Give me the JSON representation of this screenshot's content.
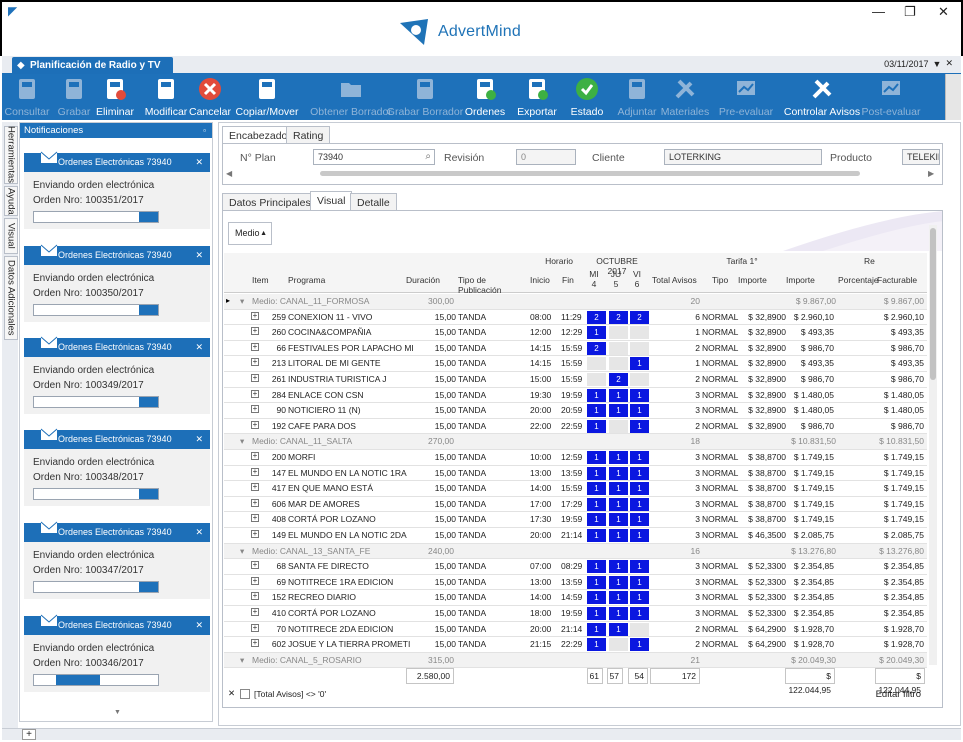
{
  "app": {
    "brand": "AdvertMind",
    "window_controls": [
      "—",
      "❐",
      "✕"
    ]
  },
  "doc_tab": {
    "title": "Planificación de Radio y TV",
    "date": "03/11/2017"
  },
  "toolbar": [
    {
      "label": "Consultar",
      "enabled": false,
      "icon": "magnifier-doc-icon"
    },
    {
      "label": "Grabar",
      "enabled": false,
      "icon": "floppy-icon"
    },
    {
      "label": "Eliminar",
      "enabled": true,
      "icon": "floppy-delete-icon"
    },
    {
      "label": "Modificar",
      "enabled": true,
      "icon": "edit-icon"
    },
    {
      "label": "Cancelar",
      "enabled": true,
      "icon": "cancel-icon"
    },
    {
      "label": "Copiar/Mover",
      "enabled": true,
      "icon": "copy-icon"
    },
    {
      "label": "Obtener Borrador",
      "enabled": false,
      "icon": "folder-icon"
    },
    {
      "label": "Grabar Borrador",
      "enabled": false,
      "icon": "floppy-icon"
    },
    {
      "label": "Ordenes",
      "enabled": true,
      "icon": "orders-icon"
    },
    {
      "label": "Exportar",
      "enabled": true,
      "icon": "export-icon"
    },
    {
      "label": "Estado",
      "enabled": true,
      "icon": "status-icon"
    },
    {
      "label": "Adjuntar",
      "enabled": false,
      "icon": "attach-icon"
    },
    {
      "label": "Materiales",
      "enabled": false,
      "icon": "tools-icon"
    },
    {
      "label": "Pre-evaluar",
      "enabled": false,
      "icon": "chart-icon"
    },
    {
      "label": "Controlar Avisos",
      "enabled": true,
      "icon": "tools-icon"
    },
    {
      "label": "Post-evaluar",
      "enabled": false,
      "icon": "chart-icon"
    }
  ],
  "side_tabs": [
    "Herramientas",
    "Ayuda",
    "Visual",
    "Datos Adicionales"
  ],
  "notifications": {
    "title": "Notificaciones",
    "items": [
      {
        "header": "Ordenes Electrónicas 73940",
        "line1": "Enviando orden electrónica",
        "line2": "Orden Nro: 100351/2017",
        "progress": 0.1
      },
      {
        "header": "Ordenes Electrónicas 73940",
        "line1": "Enviando orden electrónica",
        "line2": "Orden Nro: 100350/2017",
        "progress": 0.1
      },
      {
        "header": "Ordenes Electrónicas 73940",
        "line1": "Enviando orden electrónica",
        "line2": "Orden Nro: 100349/2017",
        "progress": 0.1
      },
      {
        "header": "Ordenes Electrónicas 73940",
        "line1": "Enviando orden electrónica",
        "line2": "Orden Nro: 100348/2017",
        "progress": 0.1
      },
      {
        "header": "Ordenes Electrónicas 73940",
        "line1": "Enviando orden electrónica",
        "line2": "Orden Nro: 100347/2017",
        "progress": 0.1
      },
      {
        "header": "Ordenes Electrónicas 73940",
        "line1": "Enviando orden electrónica",
        "line2": "Orden Nro: 100346/2017",
        "progress": 0.35
      }
    ]
  },
  "header_tabs": [
    "Encabezado",
    "Rating"
  ],
  "header_fields": {
    "plan_label": "N° Plan",
    "plan_value": "73940",
    "revision_label": "Revisión",
    "revision_value": "0",
    "client_label": "Cliente",
    "client_value": "LOTERKING",
    "product_label": "Producto",
    "product_value": "TELEKING"
  },
  "detail_tabs": [
    "Datos Principales",
    "Visual",
    "Detalle"
  ],
  "group_by": "Medio",
  "grid": {
    "band_headers": {
      "horario": "Horario",
      "month": "OCTUBRE 2017",
      "tarifa": "Tarifa 1°",
      "re": "Re"
    },
    "columns": [
      "Item",
      "Programa",
      "Duración",
      "Tipo de Publicación",
      "Inicio",
      "Fin",
      "MI 4",
      "JU 5",
      "VI 6",
      "Total Avisos",
      "Tipo",
      "Importe",
      "Importe",
      "Porcentaje",
      "Facturable"
    ],
    "groups": [
      {
        "label": "Medio: CANAL_11_FORMOSA",
        "duration": "300,00",
        "total": "20",
        "importe": "$ 9.867,00",
        "facturable": "$ 9.867,00",
        "rows": [
          {
            "item": "259",
            "program": "CONEXION 11 - VIVO",
            "dur": "15,00",
            "pub": "TANDA",
            "ini": "08:00",
            "fin": "11:29",
            "d": [
              "2",
              "2",
              "2"
            ],
            "total": "6",
            "tipo": "NORMAL",
            "imp1": "$ 32,8900",
            "imp2": "$ 2.960,10",
            "fact": "$ 2.960,10"
          },
          {
            "item": "260",
            "program": "COCINA&COMPAÑIA",
            "dur": "15,00",
            "pub": "TANDA",
            "ini": "12:00",
            "fin": "12:29",
            "d": [
              "1",
              "",
              ""
            ],
            "total": "1",
            "tipo": "NORMAL",
            "imp1": "$ 32,8900",
            "imp2": "$ 493,35",
            "fact": "$ 493,35"
          },
          {
            "item": "66",
            "program": "FESTIVALES POR LAPACHO MI",
            "dur": "15,00",
            "pub": "TANDA",
            "ini": "14:15",
            "fin": "15:59",
            "d": [
              "2",
              "",
              ""
            ],
            "total": "2",
            "tipo": "NORMAL",
            "imp1": "$ 32,8900",
            "imp2": "$ 986,70",
            "fact": "$ 986,70"
          },
          {
            "item": "213",
            "program": "LITORAL DE MI GENTE",
            "dur": "15,00",
            "pub": "TANDA",
            "ini": "14:15",
            "fin": "15:59",
            "d": [
              "",
              "",
              "1"
            ],
            "total": "1",
            "tipo": "NORMAL",
            "imp1": "$ 32,8900",
            "imp2": "$ 493,35",
            "fact": "$ 493,35"
          },
          {
            "item": "261",
            "program": "INDUSTRIA TURISTICA J",
            "dur": "15,00",
            "pub": "TANDA",
            "ini": "15:00",
            "fin": "15:59",
            "d": [
              "",
              "2",
              ""
            ],
            "total": "2",
            "tipo": "NORMAL",
            "imp1": "$ 32,8900",
            "imp2": "$ 986,70",
            "fact": "$ 986,70"
          },
          {
            "item": "284",
            "program": "ENLACE CON CSN",
            "dur": "15,00",
            "pub": "TANDA",
            "ini": "19:30",
            "fin": "19:59",
            "d": [
              "1",
              "1",
              "1"
            ],
            "total": "3",
            "tipo": "NORMAL",
            "imp1": "$ 32,8900",
            "imp2": "$ 1.480,05",
            "fact": "$ 1.480,05"
          },
          {
            "item": "90",
            "program": "NOTICIERO 11 (N)",
            "dur": "15,00",
            "pub": "TANDA",
            "ini": "20:00",
            "fin": "20:59",
            "d": [
              "1",
              "1",
              "1"
            ],
            "total": "3",
            "tipo": "NORMAL",
            "imp1": "$ 32,8900",
            "imp2": "$ 1.480,05",
            "fact": "$ 1.480,05"
          },
          {
            "item": "192",
            "program": "CAFE PARA DOS",
            "dur": "15,00",
            "pub": "TANDA",
            "ini": "22:00",
            "fin": "22:59",
            "d": [
              "1",
              "",
              "1"
            ],
            "total": "2",
            "tipo": "NORMAL",
            "imp1": "$ 32,8900",
            "imp2": "$ 986,70",
            "fact": "$ 986,70"
          }
        ]
      },
      {
        "label": "Medio: CANAL_11_SALTA",
        "duration": "270,00",
        "total": "18",
        "importe": "$ 10.831,50",
        "facturable": "$ 10.831,50",
        "rows": [
          {
            "item": "200",
            "program": "MORFI",
            "dur": "15,00",
            "pub": "TANDA",
            "ini": "10:00",
            "fin": "12:59",
            "d": [
              "1",
              "1",
              "1"
            ],
            "total": "3",
            "tipo": "NORMAL",
            "imp1": "$ 38,8700",
            "imp2": "$ 1.749,15",
            "fact": "$ 1.749,15"
          },
          {
            "item": "147",
            "program": "EL MUNDO EN LA NOTIC 1RA",
            "dur": "15,00",
            "pub": "TANDA",
            "ini": "13:00",
            "fin": "13:59",
            "d": [
              "1",
              "1",
              "1"
            ],
            "total": "3",
            "tipo": "NORMAL",
            "imp1": "$ 38,8700",
            "imp2": "$ 1.749,15",
            "fact": "$ 1.749,15"
          },
          {
            "item": "417",
            "program": "EN QUE MANO ESTÁ",
            "dur": "15,00",
            "pub": "TANDA",
            "ini": "14:00",
            "fin": "15:59",
            "d": [
              "1",
              "1",
              "1"
            ],
            "total": "3",
            "tipo": "NORMAL",
            "imp1": "$ 38,8700",
            "imp2": "$ 1.749,15",
            "fact": "$ 1.749,15"
          },
          {
            "item": "606",
            "program": "MAR DE AMORES",
            "dur": "15,00",
            "pub": "TANDA",
            "ini": "17:00",
            "fin": "17:29",
            "d": [
              "1",
              "1",
              "1"
            ],
            "total": "3",
            "tipo": "NORMAL",
            "imp1": "$ 38,8700",
            "imp2": "$ 1.749,15",
            "fact": "$ 1.749,15"
          },
          {
            "item": "408",
            "program": "CORTÁ POR LOZANO",
            "dur": "15,00",
            "pub": "TANDA",
            "ini": "17:30",
            "fin": "19:59",
            "d": [
              "1",
              "1",
              "1"
            ],
            "total": "3",
            "tipo": "NORMAL",
            "imp1": "$ 38,8700",
            "imp2": "$ 1.749,15",
            "fact": "$ 1.749,15"
          },
          {
            "item": "149",
            "program": "EL MUNDO EN LA NOTIC 2DA",
            "dur": "15,00",
            "pub": "TANDA",
            "ini": "20:00",
            "fin": "21:14",
            "d": [
              "1",
              "1",
              "1"
            ],
            "total": "3",
            "tipo": "NORMAL",
            "imp1": "$ 46,3500",
            "imp2": "$ 2.085,75",
            "fact": "$ 2.085,75"
          }
        ]
      },
      {
        "label": "Medio: CANAL_13_SANTA_FE",
        "duration": "240,00",
        "total": "16",
        "importe": "$ 13.276,80",
        "facturable": "$ 13.276,80",
        "rows": [
          {
            "item": "68",
            "program": "SANTA FE DIRECTO",
            "dur": "15,00",
            "pub": "TANDA",
            "ini": "07:00",
            "fin": "08:29",
            "d": [
              "1",
              "1",
              "1"
            ],
            "total": "3",
            "tipo": "NORMAL",
            "imp1": "$ 52,3300",
            "imp2": "$ 2.354,85",
            "fact": "$ 2.354,85"
          },
          {
            "item": "69",
            "program": "NOTITRECE 1RA EDICION",
            "dur": "15,00",
            "pub": "TANDA",
            "ini": "13:00",
            "fin": "13:59",
            "d": [
              "1",
              "1",
              "1"
            ],
            "total": "3",
            "tipo": "NORMAL",
            "imp1": "$ 52,3300",
            "imp2": "$ 2.354,85",
            "fact": "$ 2.354,85"
          },
          {
            "item": "152",
            "program": "RECREO DIARIO",
            "dur": "15,00",
            "pub": "TANDA",
            "ini": "14:00",
            "fin": "14:59",
            "d": [
              "1",
              "1",
              "1"
            ],
            "total": "3",
            "tipo": "NORMAL",
            "imp1": "$ 52,3300",
            "imp2": "$ 2.354,85",
            "fact": "$ 2.354,85"
          },
          {
            "item": "410",
            "program": "CORTÁ POR LOZANO",
            "dur": "15,00",
            "pub": "TANDA",
            "ini": "18:00",
            "fin": "19:59",
            "d": [
              "1",
              "1",
              "1"
            ],
            "total": "3",
            "tipo": "NORMAL",
            "imp1": "$ 52,3300",
            "imp2": "$ 2.354,85",
            "fact": "$ 2.354,85"
          },
          {
            "item": "70",
            "program": "NOTITRECE 2DA EDICION",
            "dur": "15,00",
            "pub": "TANDA",
            "ini": "20:00",
            "fin": "21:14",
            "d": [
              "1",
              "1",
              ""
            ],
            "total": "2",
            "tipo": "NORMAL",
            "imp1": "$ 64,2900",
            "imp2": "$ 1.928,70",
            "fact": "$ 1.928,70"
          },
          {
            "item": "602",
            "program": "JOSUE Y LA TIERRA PROMETI",
            "dur": "15,00",
            "pub": "TANDA",
            "ini": "21:15",
            "fin": "22:29",
            "d": [
              "1",
              "",
              "1"
            ],
            "total": "2",
            "tipo": "NORMAL",
            "imp1": "$ 64,2900",
            "imp2": "$ 1.928,70",
            "fact": "$ 1.928,70"
          }
        ]
      },
      {
        "label": "Medio: CANAL_5_ROSARIO",
        "duration": "315,00",
        "total": "21",
        "importe": "$ 20.049,30",
        "facturable": "$ 20.049,30",
        "rows": []
      }
    ],
    "totals": {
      "duration": "2.580,00",
      "mi": "61",
      "ju": "57",
      "vi": "54",
      "total": "172",
      "importe": "$ 122.044,95",
      "facturable": "$ 122.044,95"
    },
    "filter": "[Total Avisos] <> '0'",
    "edit_filter": "Editar filtro"
  },
  "colors": {
    "accent": "#1e71ba",
    "cell": "#0a17e0"
  }
}
